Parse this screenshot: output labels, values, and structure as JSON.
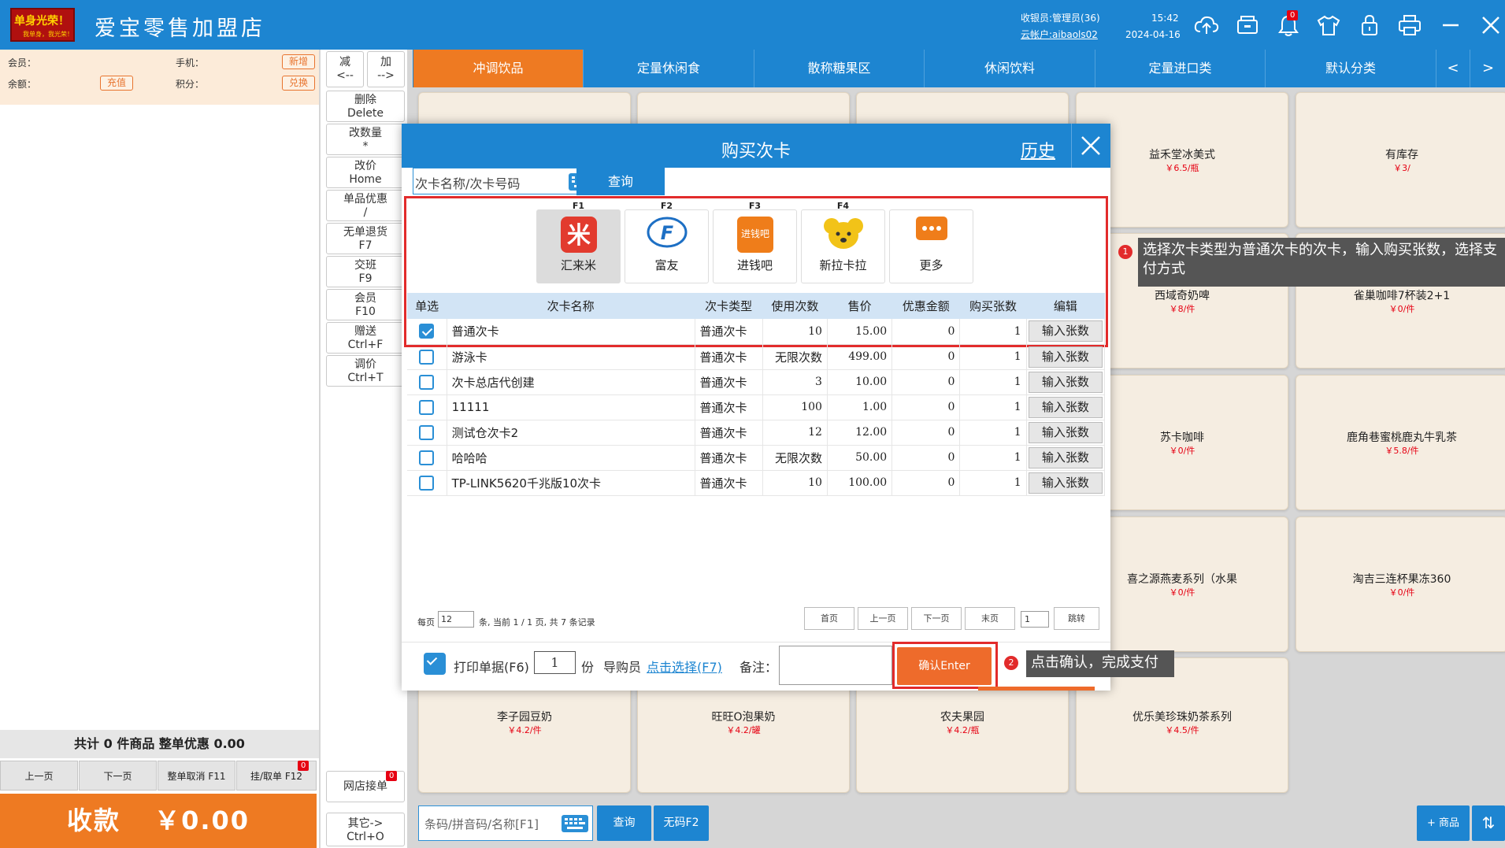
{
  "header": {
    "logo_text": "单身光荣！",
    "logo_sub": "我单身，我光荣！",
    "store_name": "爱宝零售加盟店",
    "cashier": "收银员:管理员(36)",
    "cloud_account": "云帐户:aibaols02",
    "time": "15:42",
    "date": "2024-04-16",
    "notification_count": "0",
    "icons": [
      "cloud-upload-icon",
      "cash-drawer-icon",
      "bell-icon",
      "shirt-icon",
      "lock-icon",
      "printer-icon",
      "minimize-icon",
      "close-icon"
    ]
  },
  "member": {
    "member_label": "会员：",
    "phone_label": "手机：",
    "new_btn": "新增",
    "balance_label": "余额：",
    "recharge_btn": "充值",
    "points_label": "积分：",
    "redeem_btn": "兑换"
  },
  "cart": {
    "summary": "共计 0 件商品 整单优惠 0.00",
    "prev": "上一页",
    "next": "下一页",
    "cancel_all": "整单取消 F11",
    "hold": "挂/取单 F12",
    "hold_count": "0",
    "pay_label": "收款",
    "pay_amount": "￥0.00"
  },
  "functions": {
    "minus": {
      "l1": "减",
      "l2": "<--"
    },
    "plus": {
      "l1": "加",
      "l2": "-->"
    },
    "buttons": [
      {
        "l1": "删除",
        "l2": "Delete"
      },
      {
        "l1": "改数量",
        "l2": "*"
      },
      {
        "l1": "改价",
        "l2": "Home"
      },
      {
        "l1": "单品优惠",
        "l2": "/"
      },
      {
        "l1": "无单退货",
        "l2": "F7"
      },
      {
        "l1": "交班",
        "l2": "F9"
      },
      {
        "l1": "会员",
        "l2": "F10"
      },
      {
        "l1": "赠送",
        "l2": "Ctrl+F"
      },
      {
        "l1": "调价",
        "l2": "Ctrl+T"
      }
    ],
    "online_orders": "网店接单",
    "online_count": "0",
    "other": {
      "l1": "其它->",
      "l2": "Ctrl+O"
    }
  },
  "categories": [
    "冲调饮品",
    "定量休闲食",
    "散称糖果区",
    "休闲饮料",
    "定量进口类",
    "默认分类"
  ],
  "category_prev": "<",
  "category_next": ">",
  "products": [
    {
      "name": "益禾堂冰美式",
      "price": "￥6.5/瓶"
    },
    {
      "name": "有库存",
      "price": "￥3/"
    },
    {
      "name": "西域奇奶啤",
      "price": "￥8/件"
    },
    {
      "name": "雀巢咖啡7杯装2+1",
      "price": "￥0/件"
    },
    {
      "name": "苏卡咖啡",
      "price": "￥0/件"
    },
    {
      "name": "鹿角巷蜜桃鹿丸牛乳茶",
      "price": "￥5.8/件"
    },
    {
      "name": "喜之源燕麦系列（水果",
      "price": "￥0/件"
    },
    {
      "name": "淘吉三连杯果冻360",
      "price": "￥0/件"
    },
    {
      "name": "李子园豆奶",
      "price": "￥4.2/件"
    },
    {
      "name": "旺旺O泡果奶",
      "price": "￥4.2/罐"
    },
    {
      "name": "农夫果园",
      "price": "￥4.2/瓶"
    },
    {
      "name": "优乐美珍珠奶茶系列",
      "price": "￥4.5/件"
    }
  ],
  "bottom": {
    "search_placeholder": "条码/拼音码/名称[F1]",
    "query": "查询",
    "no_barcode": "无码F2",
    "add_product": "+ 商品"
  },
  "dialog": {
    "title": "购买次卡",
    "history": "历史",
    "search_placeholder": "次卡名称/次卡号码",
    "query": "查询",
    "payment_types": [
      {
        "key": "F1",
        "name": "汇来米",
        "color": "#e23b2e"
      },
      {
        "key": "F2",
        "name": "富友",
        "color": "#1d6fc4"
      },
      {
        "key": "F3",
        "name": "进钱吧",
        "color": "#ef7d1a"
      },
      {
        "key": "F4",
        "name": "新拉卡拉",
        "color": "#f2c318"
      },
      {
        "key": "",
        "name": "更多",
        "color": "#ef7d1a"
      }
    ],
    "columns": [
      "单选",
      "次卡名称",
      "次卡类型",
      "使用次数",
      "售价",
      "优惠金额",
      "购买张数",
      "编辑"
    ],
    "rows": [
      {
        "name": "普通次卡",
        "type": "普通次卡",
        "uses": "10",
        "price": "15.00",
        "discount": "0",
        "qty": "1",
        "edit": "输入张数",
        "checked": true
      },
      {
        "name": "游泳卡",
        "type": "普通次卡",
        "uses": "无限次数",
        "price": "499.00",
        "discount": "0",
        "qty": "1",
        "edit": "输入张数",
        "checked": false
      },
      {
        "name": "次卡总店代创建",
        "type": "普通次卡",
        "uses": "3",
        "price": "10.00",
        "discount": "0",
        "qty": "1",
        "edit": "输入张数",
        "checked": false
      },
      {
        "name": "11111",
        "type": "普通次卡",
        "uses": "100",
        "price": "1.00",
        "discount": "0",
        "qty": "1",
        "edit": "输入张数",
        "checked": false
      },
      {
        "name": "测试仓次卡2",
        "type": "普通次卡",
        "uses": "12",
        "price": "12.00",
        "discount": "0",
        "qty": "1",
        "edit": "输入张数",
        "checked": false
      },
      {
        "name": "哈哈哈",
        "type": "普通次卡",
        "uses": "无限次数",
        "price": "50.00",
        "discount": "0",
        "qty": "1",
        "edit": "输入张数",
        "checked": false
      },
      {
        "name": "TP-LINK5620千兆版10次卡",
        "type": "普通次卡",
        "uses": "10",
        "price": "100.00",
        "discount": "0",
        "qty": "1",
        "edit": "输入张数",
        "checked": false
      }
    ],
    "pagination": {
      "per_page_label": "每页",
      "per_page": "12",
      "info": "条, 当前 1 / 1 页, 共 7 条记录",
      "first": "首页",
      "prev": "上一页",
      "next": "下一页",
      "last": "末页",
      "page_input": "1",
      "jump": "跳转"
    },
    "footer": {
      "print_label": "打印单据(F6)",
      "copies": "1",
      "copies_unit": "份",
      "guide_label": "导购员",
      "guide_link": "点击选择(F7)",
      "note_label": "备注：",
      "confirm": "确认Enter"
    }
  },
  "tips": {
    "tip1_num": "1",
    "tip1": "选择次卡类型为普通次卡的次卡，输入购买张数，选择支付方式",
    "tip2_num": "2",
    "tip2": "点击确认，完成支付"
  }
}
